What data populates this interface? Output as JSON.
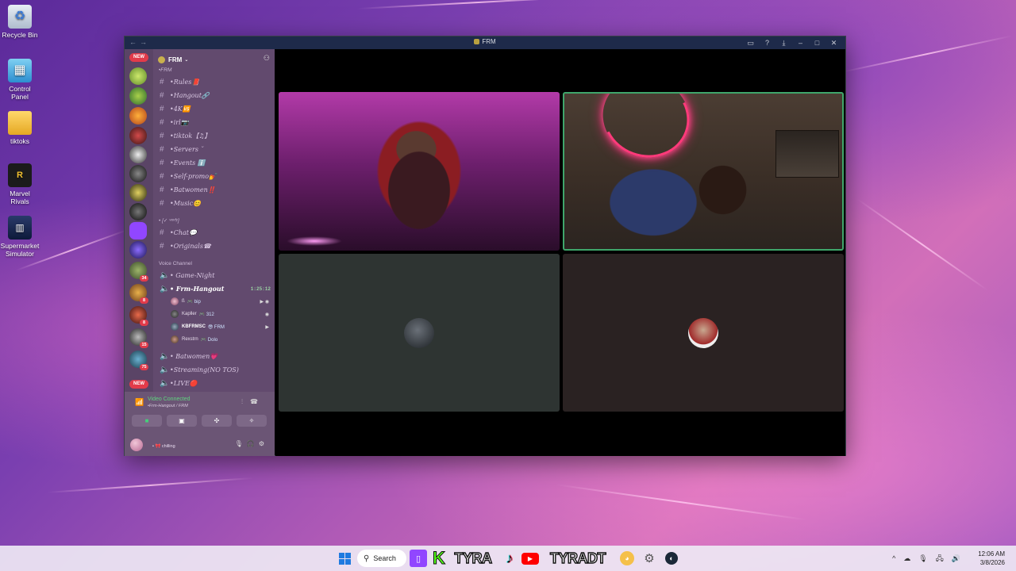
{
  "desktop": {
    "icons": [
      {
        "label": "Recycle Bin",
        "icon": "recycle-bin-icon"
      },
      {
        "label": "Control Panel",
        "icon": "control-panel-icon"
      },
      {
        "label": "tiktoks",
        "icon": "folder-icon"
      },
      {
        "label": "Marvel Rivals",
        "icon": "marvel-rivals-icon"
      },
      {
        "label": "Supermarket Simulator",
        "icon": "supermarket-simulator-icon"
      }
    ]
  },
  "window": {
    "title": "FRM",
    "controls": [
      "screen-share-icon",
      "help-icon",
      "download-icon",
      "minimize-icon",
      "maximize-icon",
      "close-icon"
    ]
  },
  "rail": {
    "new_badge_top": "NEW",
    "new_badge_bottom": "NEW",
    "mentions": [
      "34",
      "8",
      "8",
      "15",
      "75"
    ]
  },
  "server": {
    "name": "FRM",
    "categories": {
      "frm": "•FRM",
      "second": "• [✓ ᵛᵉʳᶦᶠʸ]",
      "voice": "Voice Channel"
    },
    "text_channels": [
      "•Rules📕",
      "•Hangout🔗",
      "•4K🆚",
      "•irl📷",
      "•tiktok【♫】",
      "•Servers ˘",
      "•Events ℹ️",
      "•Self-promo💅",
      "•Batwomen‼️",
      "•Music😊"
    ],
    "text_channels_2": [
      "•Chat💬",
      "•Originals☎"
    ],
    "voice_channels": [
      {
        "name": "• Game-Night",
        "active": false
      },
      {
        "name": "• Frm-Hangout",
        "active": true,
        "timer": "1:25:12"
      }
    ],
    "voice_channels_2": [
      "• Batwomen💗",
      "•Streaming(NO TOS)",
      "•LIVE🔴"
    ],
    "voice_users": [
      {
        "name": "ß",
        "status": "🎮 bip"
      },
      {
        "name": "Kapller",
        "status": "🎮 312"
      },
      {
        "name": "KBFRMSC",
        "status": "😎 FRM"
      },
      {
        "name": "Rexstrn",
        "status": "🎮 Dolo"
      }
    ]
  },
  "voice_panel": {
    "status": "Video Connected",
    "location": "•Frm-Hangout / FRM",
    "buttons": [
      "camera-icon",
      "screen-share-icon",
      "activities-icon",
      "soundboard-icon"
    ],
    "user_status": "• 🎀 chilling"
  },
  "taskbar": {
    "search_label": "Search",
    "brand_1": "TYRA",
    "brand_2": "TYRADT",
    "time": "12:06 AM",
    "date": "3/8/2026"
  },
  "colors": {
    "accent_green": "#3fa66b",
    "badge_red": "#e23b4a",
    "panel_purple": "#624a6e"
  }
}
